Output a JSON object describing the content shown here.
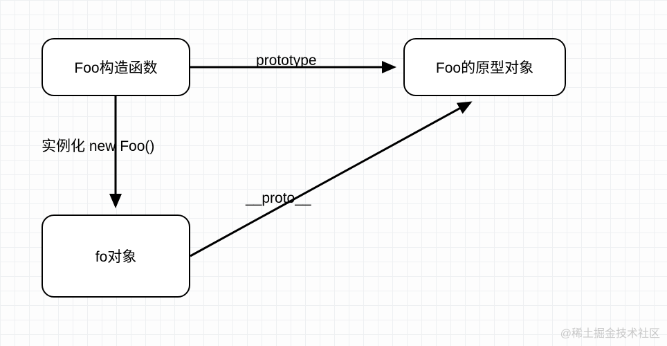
{
  "chart_data": {
    "type": "diagram",
    "title": "",
    "nodes": [
      {
        "id": "foo-constructor",
        "label": "Foo构造函数"
      },
      {
        "id": "foo-prototype",
        "label": "Foo的原型对象"
      },
      {
        "id": "fo-object",
        "label": "fo对象"
      }
    ],
    "edges": [
      {
        "from": "foo-constructor",
        "to": "foo-prototype",
        "label": "prototype"
      },
      {
        "from": "foo-constructor",
        "to": "fo-object",
        "label": "实例化 new Foo()"
      },
      {
        "from": "fo-object",
        "to": "foo-prototype",
        "label": "__proto__"
      }
    ]
  },
  "nodes": {
    "foo_constructor": "Foo构造函数",
    "foo_prototype": "Foo的原型对象",
    "fo_object": "fo对象"
  },
  "edges": {
    "prototype_label": "prototype",
    "instantiate_label": "实例化 new Foo()",
    "proto_label": "__proto__"
  },
  "watermark": "@稀土掘金技术社区"
}
